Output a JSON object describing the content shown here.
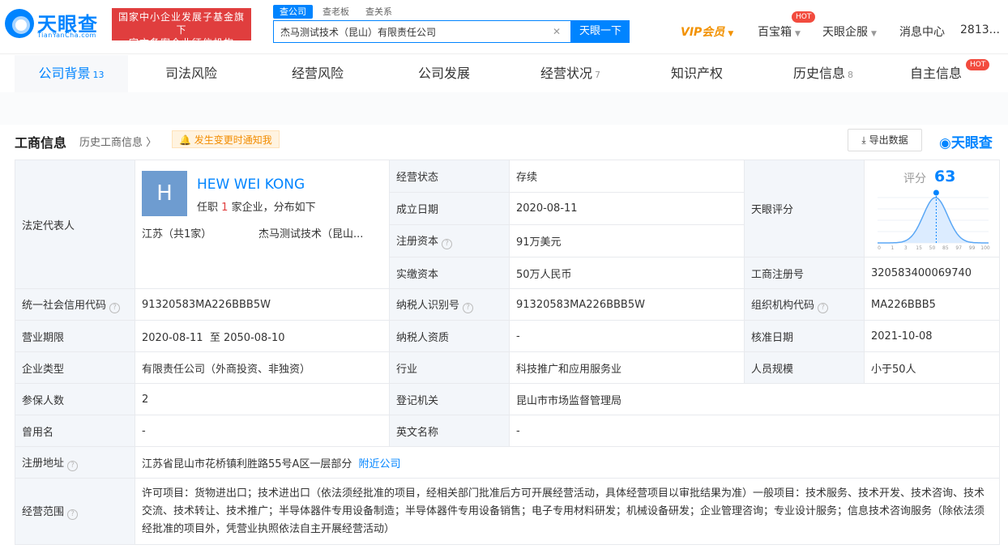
{
  "header": {
    "logo_text": "天眼查",
    "logo_sub": "TianYanCha.com",
    "fund_line1": "国家中小企业发展子基金旗下",
    "fund_line2": "官方备案企业征信机构",
    "search_tabs": [
      "查公司",
      "查老板",
      "查关系"
    ],
    "search_value": "杰马测试技术（昆山）有限责任公司",
    "search_button": "天眼一下",
    "nav": {
      "vip": "VIP会员",
      "baibao": "百宝箱",
      "hot": "HOT",
      "qifu": "天眼企服",
      "message": "消息中心",
      "user": "2813..."
    }
  },
  "tabs": [
    {
      "label": "公司背景",
      "count": "13"
    },
    {
      "label": "司法风险",
      "count": ""
    },
    {
      "label": "经营风险",
      "count": ""
    },
    {
      "label": "公司发展",
      "count": ""
    },
    {
      "label": "经营状况",
      "count": "7"
    },
    {
      "label": "知识产权",
      "count": ""
    },
    {
      "label": "历史信息",
      "count": "8"
    },
    {
      "label": "自主信息",
      "count": ""
    }
  ],
  "tab_hot": "HOT",
  "section": {
    "title": "工商信息",
    "history_link": "历史工商信息",
    "notify": "发生变更时通知我",
    "export": "导出数据",
    "brand": "天眼查"
  },
  "legal_rep": {
    "label": "法定代表人",
    "avatar": "H",
    "name": "HEW WEI KONG",
    "detail_prefix": "任职",
    "detail_count": "1",
    "detail_suffix": "家企业，分布如下",
    "region": "江苏（共1家）",
    "company": "杰马测试技术（昆山..."
  },
  "score": {
    "label": "天眼评分",
    "title": "评分",
    "value": "63",
    "value_num": 63,
    "ticks": [
      "0",
      "1",
      "3",
      "15",
      "50",
      "85",
      "97",
      "99",
      "100"
    ]
  },
  "fields": {
    "status_label": "经营状态",
    "status": "存续",
    "found_label": "成立日期",
    "found": "2020-08-11",
    "capital_label": "注册资本",
    "capital": "91万美元",
    "paid_label": "实缴资本",
    "paid": "50万人民币",
    "regno_label": "工商注册号",
    "regno": "320583400069740",
    "credit_label": "统一社会信用代码",
    "credit": "91320583MA226BBB5W",
    "taxid_label": "纳税人识别号",
    "taxid": "91320583MA226BBB5W",
    "org_label": "组织机构代码",
    "org": "MA226BBB5",
    "term_label": "营业期限",
    "term": "2020-08-11  至 2050-08-10",
    "taxqual_label": "纳税人资质",
    "taxqual": "-",
    "approve_label": "核准日期",
    "approve": "2021-10-08",
    "type_label": "企业类型",
    "type": "有限责任公司（外商投资、非独资）",
    "industry_label": "行业",
    "industry": "科技推广和应用服务业",
    "staff_label": "人员规模",
    "staff": "小于50人",
    "insured_label": "参保人数",
    "insured": "2",
    "authority_label": "登记机关",
    "authority": "昆山市市场监督管理局",
    "former_label": "曾用名",
    "former": "-",
    "english_label": "英文名称",
    "english": "-",
    "addr_label": "注册地址",
    "addr": "江苏省昆山市花桥镇利胜路55号A区一层部分",
    "addr_link": "附近公司",
    "scope_label": "经营范围",
    "scope": "许可项目：货物进出口；技术进出口（依法须经批准的项目，经相关部门批准后方可开展经营活动，具体经营项目以审批结果为准）一般项目：技术服务、技术开发、技术咨询、技术交流、技术转让、技术推广；半导体器件专用设备制造；半导体器件专用设备销售；电子专用材料研发；机械设备研发；企业管理咨询；专业设计服务；信息技术咨询服务（除依法须经批准的项目外，凭营业执照依法自主开展经营活动）"
  },
  "colors": {
    "accent": "#0084ff",
    "badge_red": "#e03e3e",
    "vip": "#f29100"
  }
}
